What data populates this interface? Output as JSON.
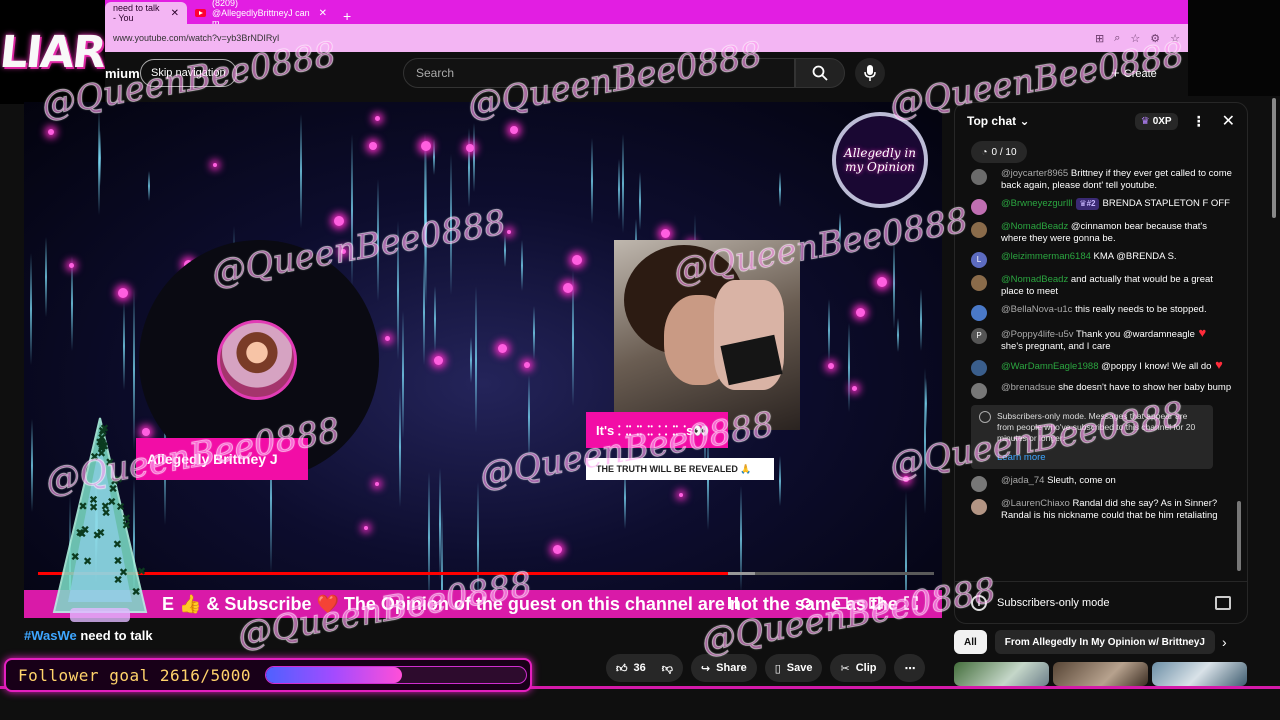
{
  "browser": {
    "tabs": [
      {
        "title": "need to talk - You"
      },
      {
        "title": "(8209) @AllegedlyBrittneyJ can m"
      }
    ],
    "url": "www.youtube.com/watch?v=yb3BrNDIRyI"
  },
  "overlay": {
    "logo_text": "LIAR",
    "watermark": "@QueenBee0888",
    "follower_goal": {
      "label": "Follower goal 2616/5000",
      "current": 2616,
      "goal": 5000
    }
  },
  "header": {
    "premium_partial": "mium",
    "skip_nav": "Skip navigation",
    "search_placeholder": "Search",
    "create_label": "Create"
  },
  "video": {
    "guest_name": "Allegedly Brittney J",
    "its_caption": "It's ⸬⸬⸬⸬ ⸬⸬s👀",
    "truth_caption": "THE TRUTH WILL BE REVEALED 🙏",
    "channel_logo_text": "Allegedly in my Opinion",
    "progress_fraction": 0.77,
    "banner_text": "E 👍 & Subscribe ❤️ The Opinion of the guest on this channel are not the same as the",
    "title_hashtag": "#WasWe",
    "title_rest": " need to talk"
  },
  "actions": {
    "like_count": "36",
    "share": "Share",
    "save": "Save",
    "clip": "Clip"
  },
  "chat": {
    "mode_label": "Top chat",
    "xp_label": "0XP",
    "goal_chip": "0 / 10",
    "messages": [
      {
        "author": "@joycarter8965",
        "text": "Brittney if they ever get called to come back again, please dont' tell youtube.",
        "color": "#6b6b6b"
      },
      {
        "author": "@Brwneyezgurlll",
        "badge": "#2",
        "text": "BRENDA STAPLETON F OFF",
        "color": "#c06fb2"
      },
      {
        "author": "@NomadBeadz",
        "text": "@cinnamon bear because that's where they were gonna be.",
        "color": "#8a6b4a"
      },
      {
        "author": "@leizimmerman6184",
        "text": "KMA @BRENDA S.",
        "color": "#5c6bc0",
        "initial": "L"
      },
      {
        "author": "@NomadBeadz",
        "text": "and actually that would be a great place to meet",
        "color": "#8a6b4a"
      },
      {
        "author": "@BellaNova-u1c",
        "text": "this really needs to be stopped.",
        "color": "#4a79c8"
      },
      {
        "author": "@Poppy4life-u5v",
        "text": "Thank you @wardamneagle",
        "text2": "she's pregnant, and I care",
        "color": "#555",
        "initial": "P"
      },
      {
        "author": "@WarDamnEagle1988",
        "text": "@poppy I know! We all do",
        "color": "#3a5e8c"
      },
      {
        "author": "@brenadsue",
        "text": "she doesn't have to show her baby bump",
        "color": "#777"
      }
    ],
    "subs_notice": "Subscribers-only mode. Messages that appear are from people who've subscribed to this channel for 20 minutes or longer.",
    "learn_more": "Learn more",
    "messages2": [
      {
        "author": "@jada_74",
        "text": "Sleuth, come on",
        "color": "#777"
      },
      {
        "author": "@LaurenChiaxo",
        "text": "Randal did she say? As in Sinner? Randal is his nickname could that be him retaliating",
        "color": "#b39584"
      }
    ],
    "footer": "Subscribers-only mode"
  },
  "chips": [
    "All",
    "From Allegedly In My Opinion w/ BrittneyJ"
  ]
}
